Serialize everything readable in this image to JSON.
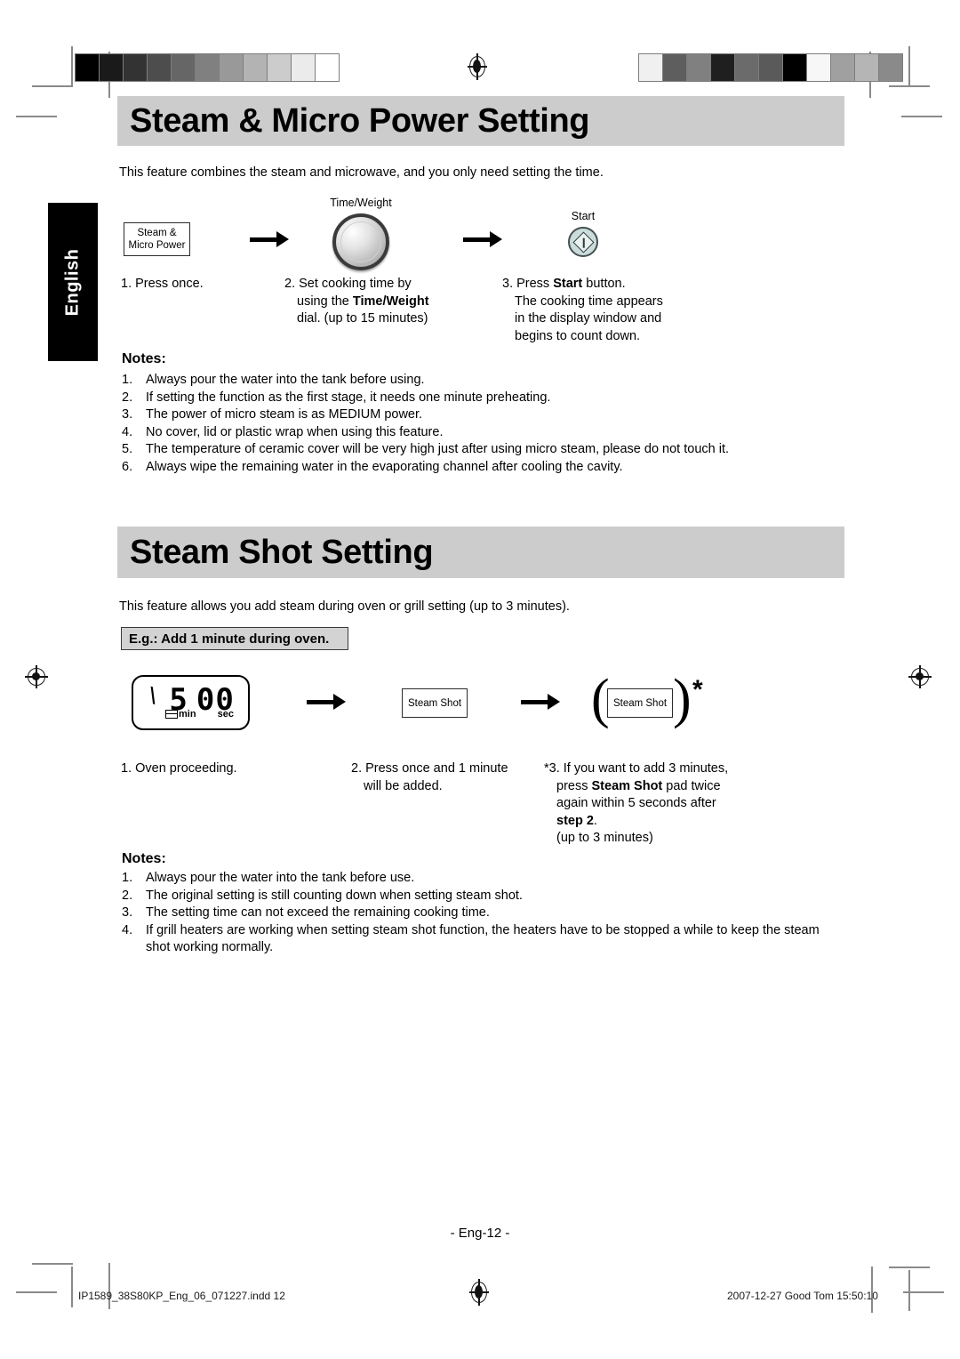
{
  "document": {
    "language_tab": "English",
    "page_number": "- Eng-12 -",
    "footer_left": "IP1589_38S80KP_Eng_06_071227.indd   12",
    "footer_right": "2007-12-27   Good Tom 15:50:10"
  },
  "calibration": {
    "left_bar": [
      "#000000",
      "#1a1a1a",
      "#333333",
      "#4d4d4d",
      "#666666",
      "#808080",
      "#999999",
      "#b3b3b3",
      "#cccccc",
      "#ebebeb",
      "#ffffff"
    ],
    "right_bar": [
      "#f0f0f0",
      "#5e5e5e",
      "#808080",
      "#1f1f1f",
      "#6b6b6b",
      "#5a5a5a",
      "#000000",
      "#f7f7f7",
      "#a0a0a0",
      "#b5b5b5",
      "#8a8a8a"
    ]
  },
  "section1": {
    "heading": "Steam & Micro Power Setting",
    "intro": "This feature combines the steam and microwave, and you only need setting the time.",
    "controls": {
      "pad_label_line1": "Steam &",
      "pad_label_line2": "Micro Power",
      "dial_caption": "Time/Weight",
      "start_caption": "Start"
    },
    "steps": [
      {
        "lines": [
          "1. Press once."
        ]
      },
      {
        "lines": [
          "2. Set cooking time by",
          "using the <b>Time/Weight</b>",
          "dial. (up to 15 minutes)"
        ]
      },
      {
        "lines": [
          "3. Press <b>Start</b> button.",
          "The cooking time appears",
          "in the display window and",
          "begins to count down."
        ]
      }
    ],
    "notes_title": "Notes:",
    "notes": [
      {
        "num": "1.",
        "text": "Always pour the water into the tank before using."
      },
      {
        "num": "2.",
        "text": "If setting the function as the first stage, it needs one minute preheating."
      },
      {
        "num": "3.",
        "text": "The power of micro steam is as MEDIUM power."
      },
      {
        "num": "4.",
        "text": "No cover, lid or plastic wrap when using this feature."
      },
      {
        "num": "5.",
        "text": "The temperature of ceramic cover will be very high just after using micro steam, please do not touch it."
      },
      {
        "num": "6.",
        "text": "Always wipe the remaining water in the evaporating channel after cooling the cavity."
      }
    ]
  },
  "section2": {
    "heading": "Steam Shot Setting",
    "intro": "This feature allows you add steam during oven or grill setting (up to 3 minutes).",
    "example_box": "E.g.: Add 1 minute during oven.",
    "display": {
      "tick": "\\",
      "minutes": "5",
      "seconds": "00",
      "unit_min": "min",
      "unit_sec": "sec"
    },
    "controls": {
      "pad_label": "Steam Shot",
      "pad_label_repeat": "Steam Shot",
      "asterisk": "*"
    },
    "steps": [
      {
        "lines": [
          "1. Oven proceeding."
        ]
      },
      {
        "lines": [
          "2. Press once and 1 minute",
          "will be added."
        ]
      },
      {
        "lines": [
          "*3. If you want to add 3 minutes,",
          "press <b>Steam Shot</b> pad twice",
          "again within 5 seconds after",
          "<b>step 2</b>.",
          "(up to 3 minutes)"
        ]
      }
    ],
    "notes_title": "Notes:",
    "notes": [
      {
        "num": "1.",
        "text": "Always pour the water into the tank before use."
      },
      {
        "num": "2.",
        "text": "The original setting is still counting down when setting steam shot."
      },
      {
        "num": "3.",
        "text": "The setting time can not exceed the remaining cooking time."
      },
      {
        "num": "4.",
        "text": "If grill heaters are working when setting steam shot function, the heaters have to be stopped a while to keep the steam shot working normally."
      }
    ]
  }
}
